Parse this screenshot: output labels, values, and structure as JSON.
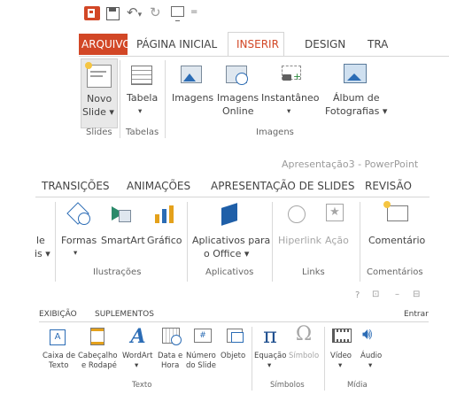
{
  "panel1": {
    "tabs": {
      "arquivo": "ARQUIVO",
      "pagina_inicial": "PÁGINA INICIAL",
      "inserir": "INSERIR",
      "design": "DESIGN",
      "tra": "TRA"
    },
    "buttons": {
      "novo_slide": [
        "Novo",
        "Slide ▾"
      ],
      "tabela": [
        "Tabela",
        "▾"
      ],
      "imagens": "Imagens",
      "imagens_online": [
        "Imagens",
        "Online"
      ],
      "instantaneo": [
        "Instantâneo",
        "▾"
      ],
      "album": [
        "Álbum de",
        "Fotografias ▾"
      ]
    },
    "groups": {
      "slides": "Slides",
      "tabelas": "Tabelas",
      "imagens": "Imagens"
    }
  },
  "panel2": {
    "window_title": "Apresentação3 - PowerPoint",
    "tabs": {
      "transicoes": "TRANSIÇÕES",
      "animacoes": "ANIMAÇÕES",
      "apresentacao": "APRESENTAÇÃO DE SLIDES",
      "revisao": "REVISÃO"
    },
    "cut_left": [
      "le",
      "is ▾"
    ],
    "buttons": {
      "formas": [
        "Formas",
        "▾"
      ],
      "smartart": "SmartArt",
      "grafico": "Gráfico",
      "aplicativos": [
        "Aplicativos para",
        "o Office ▾"
      ],
      "hiperlink": "Hiperlink",
      "acao": "Ação",
      "comentario": "Comentário"
    },
    "groups": {
      "ilustracoes": "Ilustrações",
      "aplicativos": "Aplicativos",
      "links": "Links",
      "comentarios": "Comentários"
    }
  },
  "panel3": {
    "tabs": {
      "exibicao": "EXIBIÇÃO",
      "suplementos": "SUPLEMENTOS",
      "entrar": "Entrar"
    },
    "window_controls": {
      "help": "?",
      "restore": "⊡",
      "minimize": "–",
      "maximize": "⊟"
    },
    "buttons": {
      "caixa_texto": [
        "Caixa de",
        "Texto"
      ],
      "cabecalho": [
        "Cabeçalho",
        "e Rodapé"
      ],
      "wordart": [
        "WordArt",
        "▾"
      ],
      "data_hora": [
        "Data e",
        "Hora"
      ],
      "numero_slide": [
        "Número",
        "do Slide"
      ],
      "objeto": "Objeto",
      "equacao": [
        "Equação",
        "▾"
      ],
      "simbolo": "Símbolo",
      "video": [
        "Vídeo",
        "▾"
      ],
      "audio": [
        "Áudio",
        "▾"
      ]
    },
    "groups": {
      "texto": "Texto",
      "simbolos": "Símbolos",
      "midia": "Mídia"
    }
  },
  "colors": {
    "accent": "#d24726",
    "active_tab_text": "#d24726",
    "disabled": "#a6a6a6",
    "blue": "#2b6cb5"
  }
}
